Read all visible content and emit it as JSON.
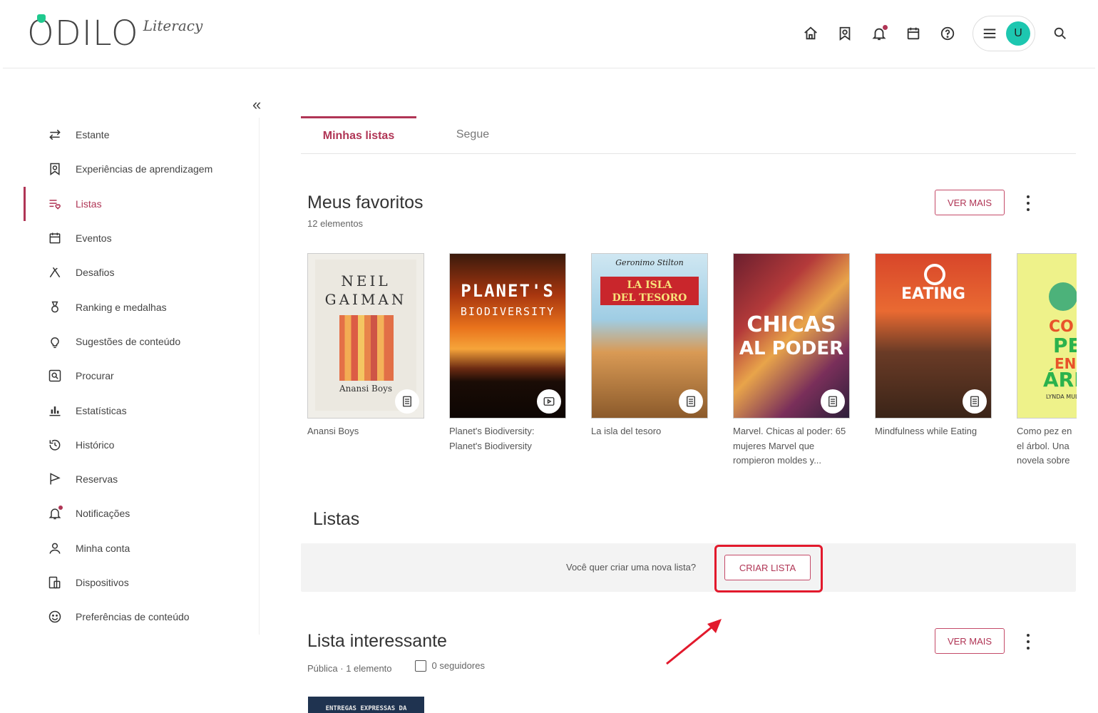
{
  "header": {
    "logo_text": "ODILO",
    "logo_sub": "Literacy",
    "icons": [
      "home-icon",
      "bookmark-badge-icon",
      "bell-icon",
      "calendar-icon",
      "help-icon",
      "menu-icon",
      "search-icon"
    ],
    "avatar_letter": "U",
    "colors": {
      "avatar": "#1dc7b0",
      "accent": "#b03555",
      "logo_dot": "#1fc98e"
    }
  },
  "sidebar": {
    "collapse_label": "«",
    "items": [
      {
        "label": "Estante",
        "icon": "swap-arrows-icon"
      },
      {
        "label": "Experiências de aprendizagem",
        "icon": "learning-experience-icon"
      },
      {
        "label": "Listas",
        "icon": "list-heart-icon",
        "active": true
      },
      {
        "label": "Eventos",
        "icon": "calendar-icon"
      },
      {
        "label": "Desafios",
        "icon": "challenge-icon"
      },
      {
        "label": "Ranking e medalhas",
        "icon": "medal-icon"
      },
      {
        "label": "Sugestões de conteúdo",
        "icon": "lightbulb-icon"
      },
      {
        "label": "Procurar",
        "icon": "search-box-icon"
      },
      {
        "label": "Estatísticas",
        "icon": "bar-chart-icon"
      },
      {
        "label": "Histórico",
        "icon": "history-icon"
      },
      {
        "label": "Reservas",
        "icon": "flag-icon"
      },
      {
        "label": "Notificações",
        "icon": "bell-icon"
      },
      {
        "label": "Minha conta",
        "icon": "user-icon"
      },
      {
        "label": "Dispositivos",
        "icon": "devices-icon"
      },
      {
        "label": "Preferências de conteúdo",
        "icon": "smiley-icon"
      }
    ]
  },
  "tabs": [
    {
      "label": "Minhas listas",
      "active": true
    },
    {
      "label": "Segue",
      "active": false
    }
  ],
  "favorites": {
    "title": "Meus favoritos",
    "count": "12 elementos",
    "more_label": "VER MAIS",
    "books": [
      {
        "title": "Anansi Boys",
        "type": "book-icon",
        "cover_lines": [
          "NEIL",
          "GAIMAN",
          "Anansi Boys"
        ]
      },
      {
        "title": "Planet's Biodiversity: Planet's Biodiversity",
        "type": "video-icon",
        "cover_lines": [
          "PLANET'S",
          "BIODIVERSITY"
        ]
      },
      {
        "title": "La isla del tesoro",
        "type": "book-icon",
        "cover_lines": [
          "Geronimo Stilton",
          "LA ISLA",
          "DEL TESORO"
        ]
      },
      {
        "title": "Marvel. Chicas al poder: 65 mujeres Marvel que rompieron moldes y...",
        "type": "book-icon",
        "cover_lines": [
          "CHICAS",
          "AL PODER"
        ]
      },
      {
        "title": "Mindfulness while Eating",
        "type": "book-icon",
        "cover_lines": [
          "EATING"
        ]
      },
      {
        "title": "Como pez en el árbol. Una novela sobre la dislexia",
        "type": "book-icon",
        "cover_lines": [
          "CO",
          "PE",
          "EN",
          "ÁRE",
          "LYNDA MUL"
        ]
      }
    ]
  },
  "lists": {
    "title": "Listas",
    "create_question": "Você quer criar uma nova lista?",
    "create_label": "CRIAR LISTA"
  },
  "interesting": {
    "title": "Lista interessante",
    "meta": "Pública · 1 elemento",
    "followers": "0 seguidores",
    "more_label": "VER MAIS",
    "cover_text": "ENTREGAS EXPRESSAS DA"
  }
}
